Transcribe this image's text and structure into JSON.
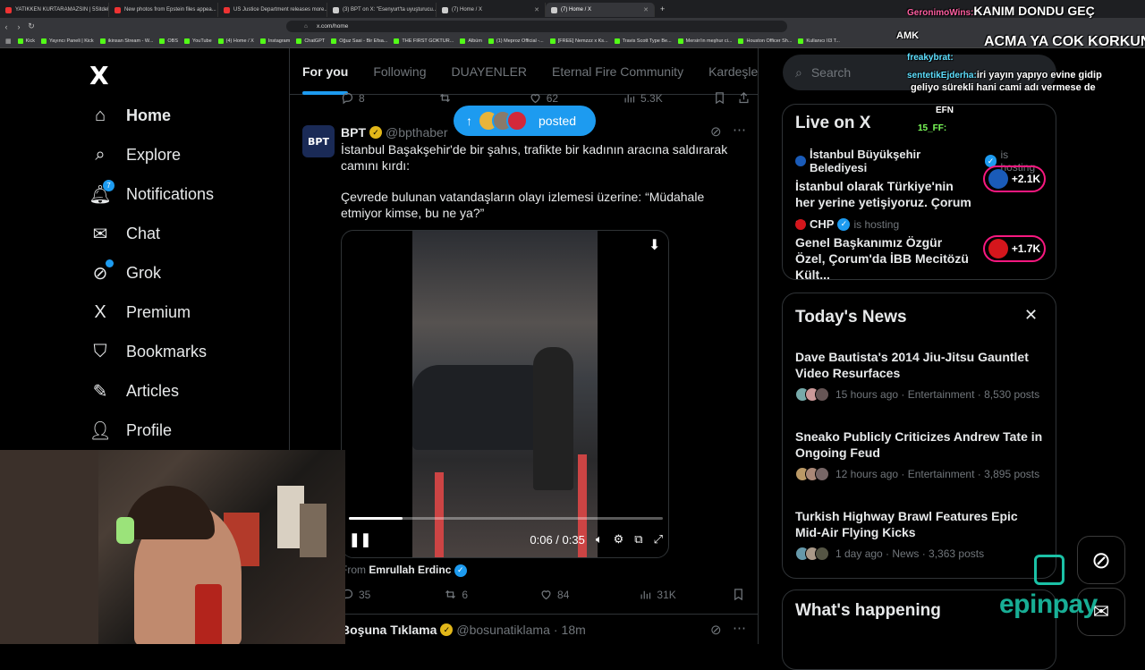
{
  "browser": {
    "tabs": [
      {
        "title": "YATIKKEN KURTARAMAZSIN | 5Sitdel...",
        "color": "#e33"
      },
      {
        "title": "New photos from Epstein files appea...",
        "color": "#e33"
      },
      {
        "title": "US Justice Department releases more...",
        "color": "#e33"
      },
      {
        "title": "(3) BPT on X: \"Esenyurt'ta uyuşturucu...",
        "color": "#ccc"
      },
      {
        "title": "(7) Home / X",
        "color": "#ccc"
      },
      {
        "title": "(7) Home / X",
        "color": "#ccc"
      }
    ],
    "url": "x.com/home",
    "bookmarks": [
      "Kick",
      "Yayıncı Paneli | Kick",
      "ikinsan Stream - W...",
      "OBS",
      "YouTube",
      "(4) Home / X",
      "Instagram",
      "ChatGPT",
      "Oğuz Sasi - Bir Efsa...",
      "THE FIRST GOKTUR...",
      "Albüm",
      "(1) Meproz Official -...",
      "[FREE] Nemzzz x Ks...",
      "Travis Scott Type Be...",
      "Mersin'in meşhur ci...",
      "Houston Officer Sh...",
      "Kullanıcı II3 T..."
    ]
  },
  "nav": {
    "logo": "X",
    "items": [
      {
        "label": "Home",
        "icon": "home-icon"
      },
      {
        "label": "Explore",
        "icon": "search-icon"
      },
      {
        "label": "Notifications",
        "icon": "bell-icon",
        "badge": "7"
      },
      {
        "label": "Chat",
        "icon": "mail-icon"
      },
      {
        "label": "Grok",
        "icon": "grok-icon"
      },
      {
        "label": "Premium",
        "icon": "x-icon"
      },
      {
        "label": "Bookmarks",
        "icon": "bookmark-icon"
      },
      {
        "label": "Articles",
        "icon": "article-icon"
      },
      {
        "label": "Profile",
        "icon": "person-icon"
      }
    ]
  },
  "feed": {
    "tabs": [
      "For you",
      "Following",
      "DUAYENLER",
      "Eternal Fire Community",
      "Kardeşler Ki"
    ],
    "prev_metrics": {
      "replies": "8",
      "likes": "62",
      "views": "5.3K"
    },
    "posted_label": "posted",
    "tweet": {
      "avatar_text": "BPT",
      "name": "BPT",
      "handle": "@bpthaber",
      "text1": "İstanbul Başakşehir'de bir şahıs, trafikte bir kadının aracına saldırarak camını kırdı:",
      "text2": "Çevrede bulunan vatandaşların olayı izlemesi üzerine: “Müdahale etmiyor kimse, bu ne ya?”",
      "video_time": "0:06 / 0:35",
      "video_progress": 0.17,
      "from_label": "From",
      "from_user": "Emrullah Erdinc",
      "replies": "35",
      "reposts": "6",
      "likes": "84",
      "views": "31K"
    },
    "next_tweet": {
      "name": "Boşuna Tıklama",
      "handle": "@bosunatiklama",
      "time": "18m"
    }
  },
  "right": {
    "search_placeholder": "Search",
    "live_title": "Live on X",
    "live": [
      {
        "user": "İstanbul Büyükşehir Belediyesi",
        "status": "is hosting",
        "title": "İstanbul olarak Türkiye'nin her yerine yetişiyoruz. Çorum ...",
        "count": "+2.1K",
        "color": "#1a5bb8"
      },
      {
        "user": "CHP",
        "status": "is hosting",
        "title": "Genel Başkanımız Özgür Özel, Çorum'da İBB Mecitözü Kült...",
        "count": "+1.7K",
        "color": "#d4161c"
      }
    ],
    "news_title": "Today's News",
    "news": [
      {
        "title": "Dave Bautista's 2014 Jiu-Jitsu Gauntlet Video Resurfaces",
        "meta": "15 hours ago · Entertainment · 8,530 posts"
      },
      {
        "title": "Sneako Publicly Criticizes Andrew Tate in Ongoing Feud",
        "meta": "12 hours ago · Entertainment · 3,895 posts"
      },
      {
        "title": "Turkish Highway Brawl Features Epic Mid-Air Flying Kicks",
        "meta": "1 day ago · News · 3,363 posts"
      }
    ],
    "happening_title": "What's happening"
  },
  "chat": [
    {
      "user": "GeronimoWins:",
      "msg": "KANIM DONDU GEÇ",
      "ucolor": "#ff5ea0"
    },
    {
      "user": "",
      "msg": "AMK",
      "ucolor": "#fff"
    },
    {
      "user": "",
      "msg": "ACMA YA COK KORKUNC AM",
      "ucolor": "#fff"
    },
    {
      "user": "sentetikEjderha:",
      "msg": "iri yayın yapıyo evine gidip",
      "ucolor": "#5ee0ff"
    },
    {
      "user": "freakybrat:",
      "msg": "",
      "ucolor": "#5ee0ff"
    },
    {
      "user": "",
      "msg": "geliyo sürekli hani cami adı vermese de",
      "ucolor": "#fff"
    },
    {
      "user": "",
      "msg": "EFN",
      "ucolor": "#ff4040"
    },
    {
      "user": "15_FF:",
      "msg": "",
      "ucolor": "#7dff5a"
    }
  ],
  "watermark": "epinpay"
}
